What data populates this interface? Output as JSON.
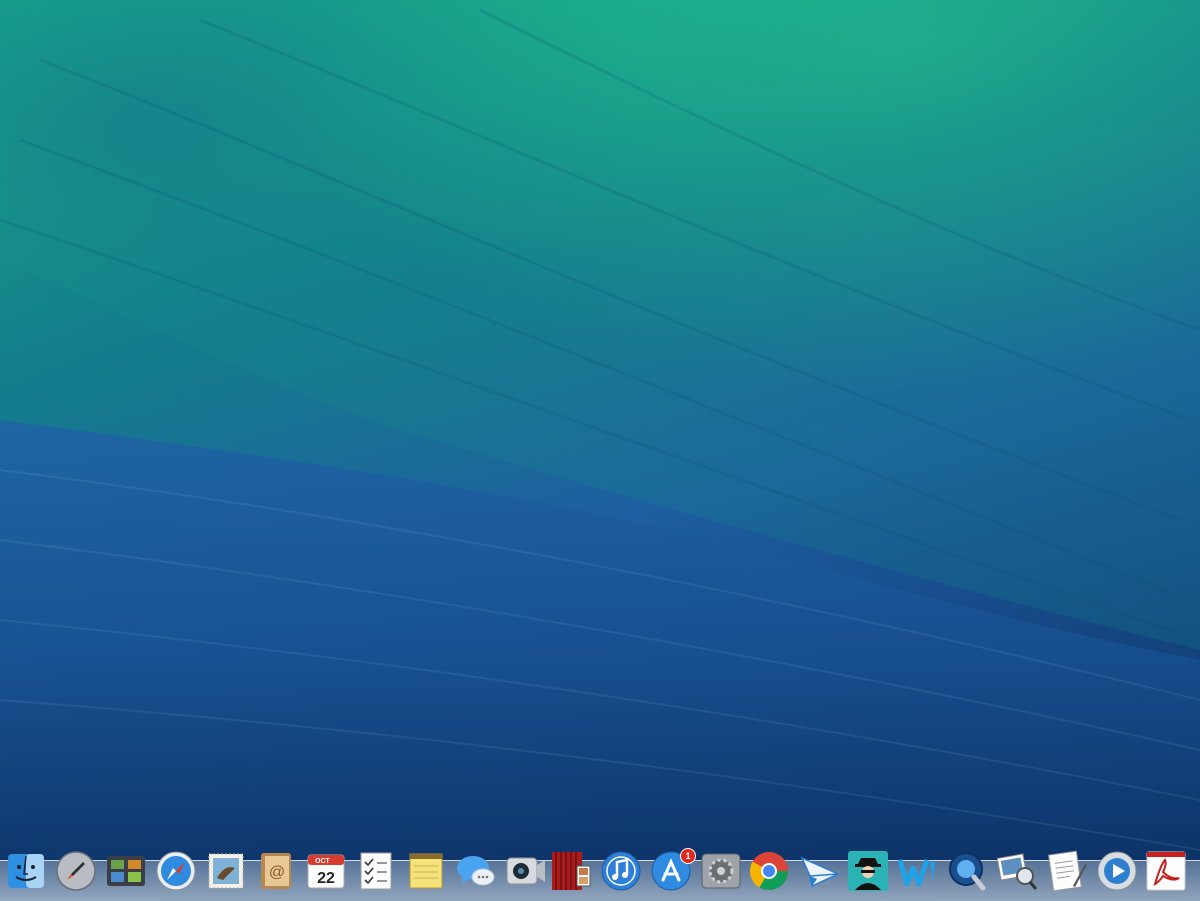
{
  "desktop": {
    "wallpaper": "ocean-wave",
    "colors": {
      "top": "#18b08a",
      "middle": "#1d5fa0",
      "bottom": "#0c2f62"
    }
  },
  "dock": {
    "items": [
      {
        "name": "finder",
        "icon": "finder-icon"
      },
      {
        "name": "launchpad",
        "icon": "rocket-icon"
      },
      {
        "name": "mission-control",
        "icon": "mission-control-icon"
      },
      {
        "name": "safari",
        "icon": "compass-icon"
      },
      {
        "name": "mail",
        "icon": "stamp-icon"
      },
      {
        "name": "contacts",
        "icon": "address-book-icon"
      },
      {
        "name": "calendar",
        "icon": "calendar-icon",
        "month": "OCT",
        "day": "22"
      },
      {
        "name": "reminders",
        "icon": "checklist-icon"
      },
      {
        "name": "notes",
        "icon": "notepad-icon"
      },
      {
        "name": "messages",
        "icon": "speech-bubble-icon"
      },
      {
        "name": "facetime",
        "icon": "camera-icon"
      },
      {
        "name": "photo-booth",
        "icon": "curtain-icon"
      },
      {
        "name": "itunes",
        "icon": "music-note-icon"
      },
      {
        "name": "app-store",
        "icon": "app-store-icon",
        "badge": "1"
      },
      {
        "name": "system-preferences",
        "icon": "gear-icon"
      },
      {
        "name": "chrome",
        "icon": "chrome-icon"
      },
      {
        "name": "airmail",
        "icon": "paper-plane-icon"
      },
      {
        "name": "spy-app",
        "icon": "spy-icon"
      },
      {
        "name": "word-app",
        "icon": "w-letter-icon"
      },
      {
        "name": "quicktime",
        "icon": "quicktime-icon"
      },
      {
        "name": "preview",
        "icon": "photos-magnifier-icon"
      },
      {
        "name": "textedit",
        "icon": "document-pen-icon"
      },
      {
        "name": "media-player",
        "icon": "play-circle-icon"
      },
      {
        "name": "acrobat",
        "icon": "pdf-icon"
      }
    ]
  }
}
